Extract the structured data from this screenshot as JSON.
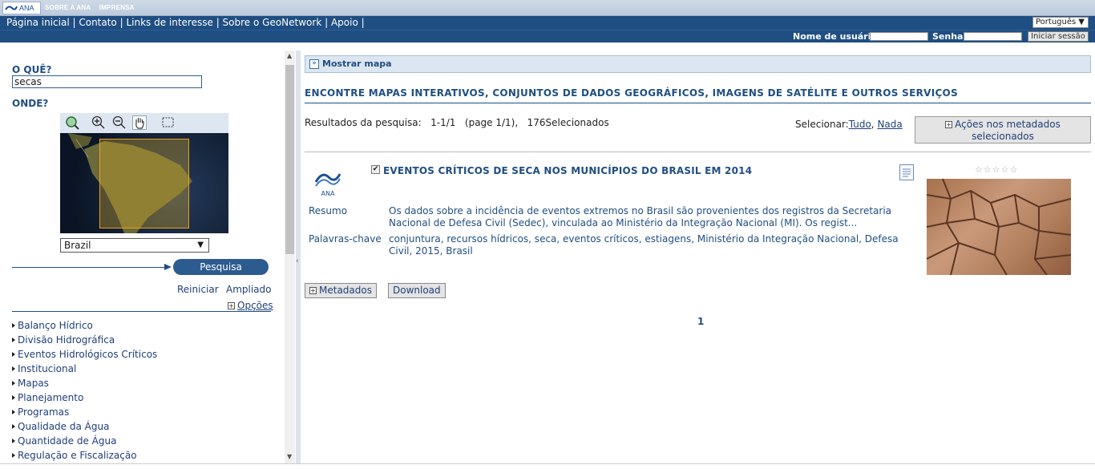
{
  "topbar": {
    "logo_text": "ANA",
    "links": [
      "SOBRE A ANA",
      "IMPRENSA"
    ]
  },
  "nav": {
    "links": [
      "Página inicial",
      "Contato",
      "Links de interesse",
      "Sobre o GeoNetwork",
      "Apoio"
    ],
    "language": "Português"
  },
  "login": {
    "username_label": "Nome de usuário",
    "password_label": "Senha",
    "button": "Iniciar sessão"
  },
  "left": {
    "what_label": "O QUÊ?",
    "search_value": "secas",
    "where_label": "ONDE?",
    "region": "Brazil",
    "search_button": "Pesquisa",
    "reset_link": "Reiniciar",
    "advanced_link": "Ampliado",
    "options_link": "Opções",
    "categories": [
      "Balanço Hídrico",
      "Divisão Hidrográfica",
      "Eventos Hidrológicos Críticos",
      "Institucional",
      "Mapas",
      "Planejamento",
      "Programas",
      "Qualidade da Água",
      "Quantidade de Água",
      "Regulação e Fiscalização"
    ]
  },
  "right": {
    "show_map": "Mostrar mapa",
    "heading": "ENCONTRE MAPAS INTERATIVOS, CONJUNTOS DE DADOS GEOGRÁFICOS, IMAGENS DE SATÉLITE E OUTROS SERVIÇOS",
    "results_label": "Resultados da pesquisa:",
    "results_range": "1-1/1",
    "results_page": "(page 1/1),",
    "results_selected": "176Selecionados",
    "select_label": "Selecionar:",
    "select_all": "Tudo",
    "select_none": "Nada",
    "actions_button": "Ações nos metadados selecionados",
    "result": {
      "logo_text": "ANA",
      "title": "EVENTOS CRÍTICOS DE SECA NOS MUNICÍPIOS DO BRASIL EM 2014",
      "summary_label": "Resumo",
      "summary": "Os dados sobre a incidência de eventos extremos no Brasil são provenientes dos registros da Secretaria Nacional de Defesa Civil (Sedec), vinculada ao Ministério da Integração Nacional (MI). Os regist...",
      "keywords_label": "Palavras-chave",
      "keywords": "conjuntura, recursos hídricos, seca, eventos críticos, estiagens, Ministério da Integração Nacional, Defesa Civil, 2015, Brasil",
      "rating_stars": 0
    },
    "metadata_button": "Metadados",
    "download_button": "Download",
    "page_number": "1"
  }
}
